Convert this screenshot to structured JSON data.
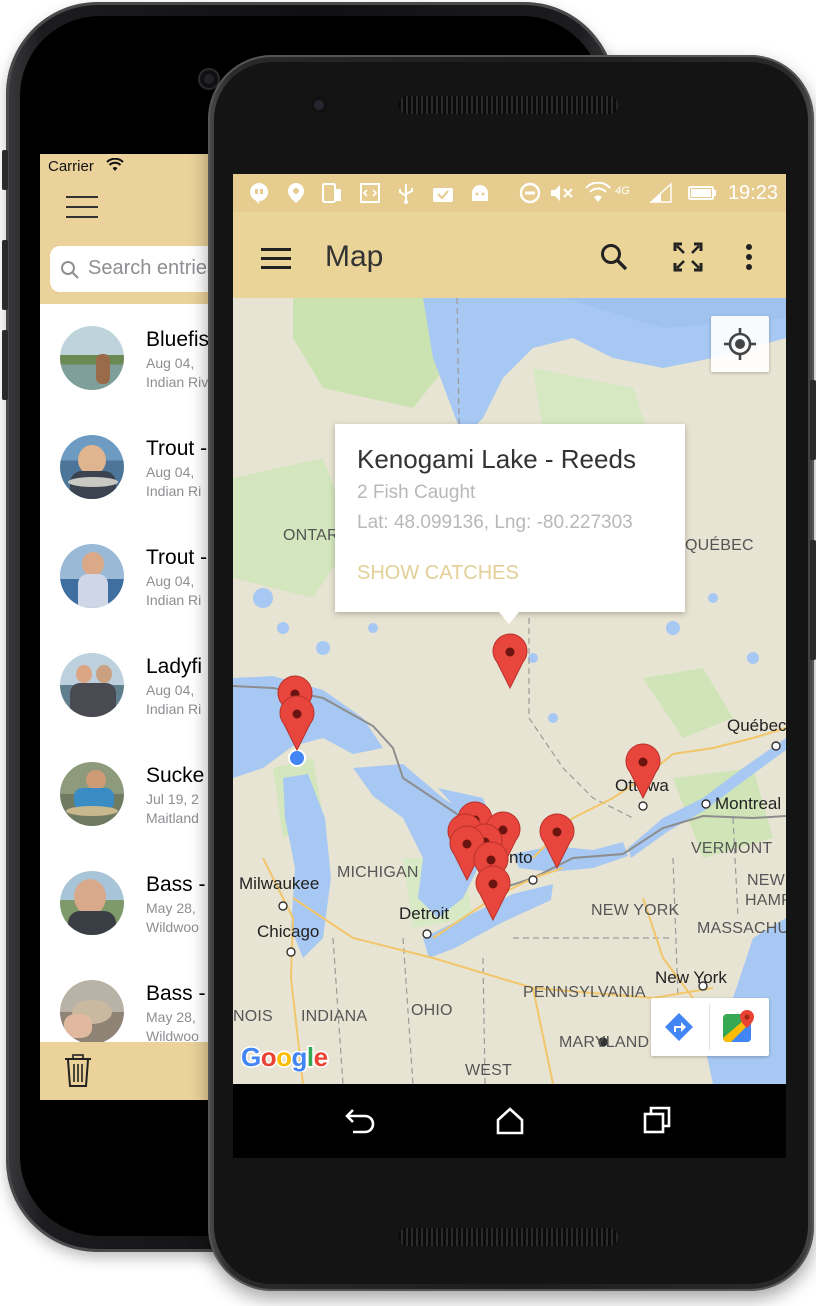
{
  "ios_app": {
    "status": {
      "carrier": "Carrier",
      "wifi_icon": "wifi-icon"
    },
    "header": {
      "menu_icon": "hamburger-menu-icon"
    },
    "search": {
      "placeholder": "Search entries"
    },
    "entries": [
      {
        "title": "Bluefish",
        "date": "Aug 04,",
        "place": "Indian River"
      },
      {
        "title": "Trout -",
        "date": "Aug 04,",
        "place": "Indian Ri"
      },
      {
        "title": "Trout -",
        "date": "Aug 04,",
        "place": "Indian Ri"
      },
      {
        "title": "Ladyfi",
        "date": "Aug 04,",
        "place": "Indian Ri"
      },
      {
        "title": "Sucke",
        "date": "Jul 19, 2",
        "place": "Maitland"
      },
      {
        "title": "Bass -",
        "date": "May 28,",
        "place": "Wildwoo"
      },
      {
        "title": "Bass -",
        "date": "May 28,",
        "place": "Wildwoo"
      }
    ],
    "toolbar": {
      "trash_icon": "trash-icon"
    },
    "colors": {
      "accent": "#ead29a"
    }
  },
  "android_app": {
    "status_bar": {
      "time": "19:23",
      "network": "4G"
    },
    "app_bar": {
      "title": "Map",
      "icons": [
        "hamburger-menu-icon",
        "search-icon",
        "fullscreen-icon",
        "more-vert-icon"
      ]
    },
    "info_window": {
      "title": "Kenogami Lake - Reeds",
      "subtitle": "2 Fish Caught",
      "coords": "Lat: 48.099136, Lng: -80.227303",
      "action": "SHOW CATCHES"
    },
    "map": {
      "region_labels": [
        "ONTARIO",
        "QUÉBEC",
        "MICHIGAN",
        "NEW YORK",
        "VERMONT",
        "NEW HAMPSHIRE",
        "MASSACHUSETTS",
        "PENNSYLVANIA",
        "OHIO",
        "INDIANA",
        "ILLINOIS",
        "MARYLAND",
        "WEST"
      ],
      "labels": {
        "ontario": "ONTAR",
        "quebec": "QUÉBEC",
        "michigan": "MICHIGAN",
        "newyork_state": "NEW YORK",
        "vermont": "VERMONT",
        "newhampshire_1": "NEW",
        "newhampshire_2": "HAMPSH",
        "massachusetts": "MASSACHU",
        "pennsylvania": "PENNSYLVANIA",
        "ohio": "OHIO",
        "indiana": "INDIANA",
        "illinois": "NOIS",
        "maryland": "MARYLAND",
        "west": "WEST"
      },
      "cities": {
        "quebec_city": "Québec",
        "ottawa": "Ottawa",
        "montreal": "Montreal",
        "milwaukee": "Milwaukee",
        "chicago": "Chicago",
        "detroit": "Detroit",
        "toronto": "nto",
        "new_york": "New York"
      },
      "logo": "Google",
      "marker_color": "#e8453c",
      "controls": [
        "my-location-icon",
        "directions-icon",
        "google-maps-icon"
      ]
    },
    "nav_bar": {
      "icons": [
        "back-icon",
        "home-icon",
        "recents-icon"
      ]
    },
    "colors": {
      "accent": "#ebd498",
      "action": "#e3cf97"
    }
  }
}
